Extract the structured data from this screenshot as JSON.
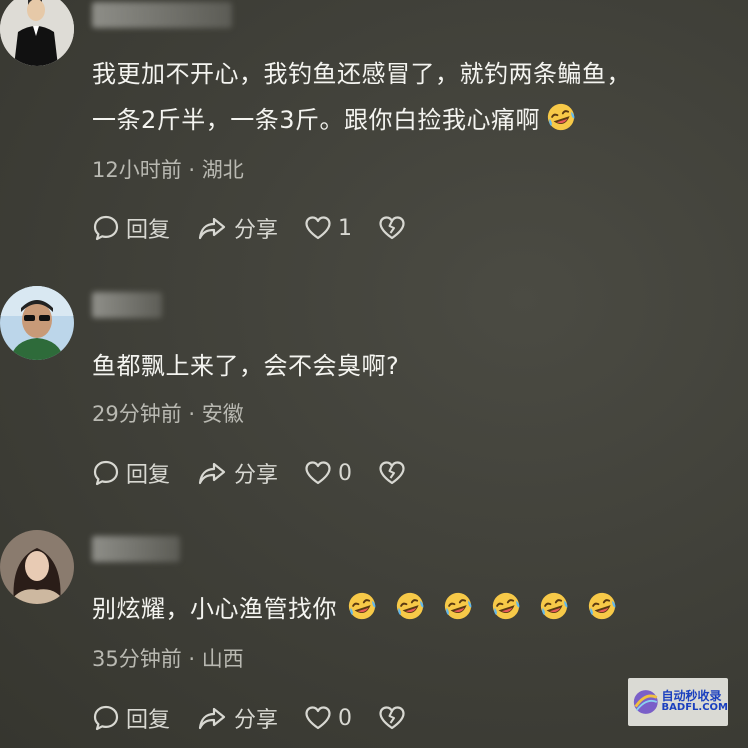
{
  "comments": [
    {
      "text_line1": "我更加不开心，我钓鱼还感冒了，就钓两条鳊鱼，",
      "text_line2": "一条2斤半，一条3斤。跟你白捡我心痛啊",
      "time": "12小时前",
      "sep": "·",
      "location": "湖北",
      "reply": "回复",
      "share": "分享",
      "likes": "1"
    },
    {
      "text_line1": "鱼都飘上来了，会不会臭啊?",
      "time": "29分钟前",
      "sep": "·",
      "location": "安徽",
      "reply": "回复",
      "share": "分享",
      "likes": "0"
    },
    {
      "text_line1": "别炫耀，小心渔管找你",
      "time": "35分钟前",
      "sep": "·",
      "location": "山西",
      "reply": "回复",
      "share": "分享",
      "likes": "0"
    }
  ],
  "emoji": "rolling-on-floor-laughing",
  "watermark": {
    "cn": "自动秒收录",
    "en": "BADFL.COM"
  },
  "colors": {
    "background": "#3f3f38",
    "text": "#f4f4f0",
    "meta": "#b9b9b2",
    "watermark_blue": "#1a3fbf"
  }
}
